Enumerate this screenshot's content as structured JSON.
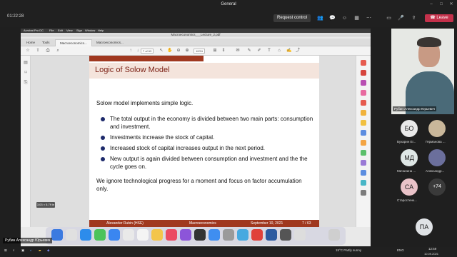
{
  "meeting": {
    "time": "01:22:28",
    "title": "General",
    "request_control": "Request control",
    "leave": "Leave",
    "presenter_name": "Рубин Александр Юрьевич"
  },
  "pdf_app": {
    "window_title": "Macroeconomics___Lecture_2.pdf",
    "menu": [
      "Acrobat Pro DC",
      "File",
      "Edit",
      "View",
      "Sign",
      "Window",
      "Help"
    ],
    "tabs": [
      "Home",
      "Tools",
      "Macroeconomics...",
      "Macroeconomics..."
    ],
    "page_box": "7 of 63",
    "zoom": "100%",
    "page_indicator": "3.03 × 5.79 in"
  },
  "slide": {
    "title": "Logic of Solow Model",
    "intro": "Solow model implements simple logic.",
    "bullets": [
      "The total output in the economy is divided between two main parts: consumption and investment.",
      "Investments increase the stock of capital.",
      "Increased stock of capital increases output in the next period.",
      "New output is again divided between consumption and investment and the the cycle goes on."
    ],
    "note": "We ignore technological progress for a moment and focus on factor accumulation only.",
    "footer": {
      "author": "Alexander Rubin (HSE)",
      "course": "Macroeconomics",
      "date": "September 10, 2021",
      "page": "7 / 63"
    }
  },
  "participants": {
    "self_label": "Рубин Александр Юрьевич",
    "people": [
      {
        "initials": "БО",
        "name": "Бухарин Ег...",
        "color": "#e9e9e9"
      },
      {
        "initials": "",
        "name": "Германова ...",
        "color": "#c9b79a"
      },
      {
        "initials": "МД",
        "name": "Мачалина ...",
        "color": "#dfe7e6"
      },
      {
        "initials": "",
        "name": "Александр...",
        "color": "#6b6f9c"
      },
      {
        "initials": "СА",
        "name": "Старостенк...",
        "color": "#e9c2c8"
      },
      {
        "initials": "+74",
        "name": "",
        "color": "#3a3a3a"
      },
      {
        "initials": "ПА",
        "name": "",
        "color": "#dfe2e5"
      }
    ]
  },
  "taskbar": {
    "weather": "15°C  Partly sunny",
    "lang": "ENG",
    "clock_time": "12:59",
    "clock_date": "10.09.2021"
  }
}
